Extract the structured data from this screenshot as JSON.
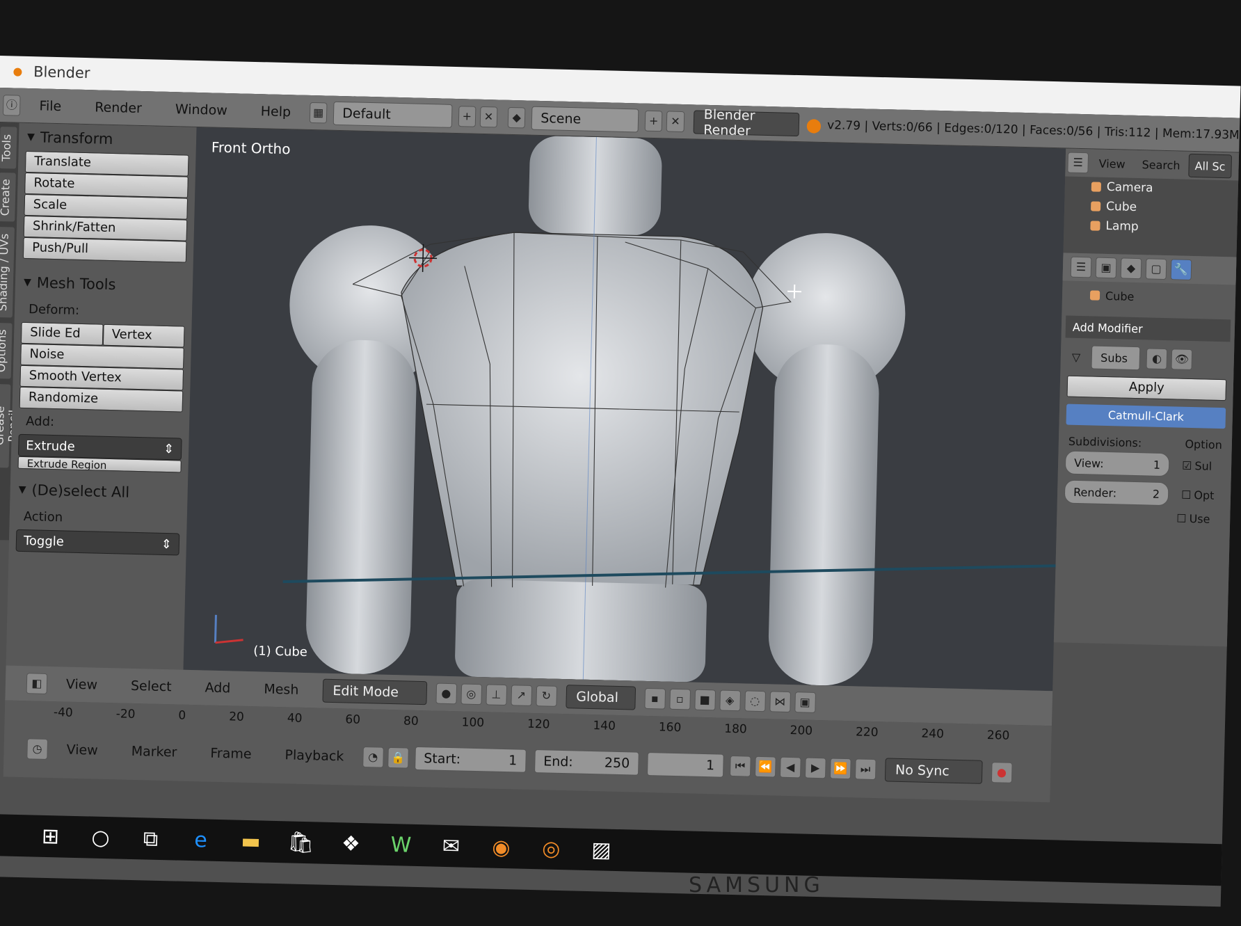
{
  "window": {
    "title": "Blender"
  },
  "topbar": {
    "menus": [
      "File",
      "Render",
      "Window",
      "Help"
    ],
    "layout": "Default",
    "scene": "Scene",
    "engine": "Blender Render",
    "stats": "v2.79 | Verts:0/66 | Edges:0/120 | Faces:0/56 | Tris:112 | Mem:17.93M"
  },
  "vtabs": [
    "Tools",
    "Create",
    "Shading / UVs",
    "Options",
    "Grease Pencil"
  ],
  "toolshelf": {
    "transform_title": "Transform",
    "transform_buttons": [
      "Translate",
      "Rotate",
      "Scale",
      "Shrink/Fatten",
      "Push/Pull"
    ],
    "mesh_tools_title": "Mesh Tools",
    "deform_label": "Deform:",
    "deform_row": [
      "Slide Ed",
      "Vertex"
    ],
    "deform_buttons": [
      "Noise",
      "Smooth Vertex",
      "Randomize"
    ],
    "add_label": "Add:",
    "extrude": "Extrude",
    "extrude_region": "Extrude Region",
    "deselect_title": "(De)select All",
    "action_label": "Action",
    "toggle": "Toggle"
  },
  "viewport": {
    "title": "Front Ortho",
    "object_label": "(1) Cube"
  },
  "vp_header": {
    "menus": [
      "View",
      "Select",
      "Add",
      "Mesh"
    ],
    "mode": "Edit Mode",
    "orientation": "Global"
  },
  "timeline": {
    "ruler": [
      "-40",
      "-20",
      "0",
      "20",
      "40",
      "60",
      "80",
      "100",
      "120",
      "140",
      "160",
      "180",
      "200",
      "220",
      "240",
      "260"
    ],
    "menus": [
      "View",
      "Marker",
      "Frame",
      "Playback"
    ],
    "start_label": "Start:",
    "start_value": "1",
    "end_label": "End:",
    "end_value": "250",
    "current": "1",
    "sync": "No Sync"
  },
  "outliner": {
    "menus": [
      "View",
      "Search",
      "All Sc"
    ],
    "items": [
      "Camera",
      "Cube",
      "Lamp"
    ]
  },
  "props": {
    "object": "Cube",
    "add_modifier": "Add Modifier",
    "mod_name": "Subs",
    "apply": "Apply",
    "algorithm": "Catmull-Clark",
    "subdivisions_label": "Subdivisions:",
    "options_label": "Option",
    "view_label": "View:",
    "view_value": "1",
    "render_label": "Render:",
    "render_value": "2",
    "checks": [
      "Sul",
      "Opt",
      "Use"
    ]
  },
  "monitor_brand": "SAMSUNG",
  "colors": {
    "accent": "#5680c2",
    "vertex_dot": "#e87d0d",
    "mesh_light": "#dcdfe3"
  }
}
